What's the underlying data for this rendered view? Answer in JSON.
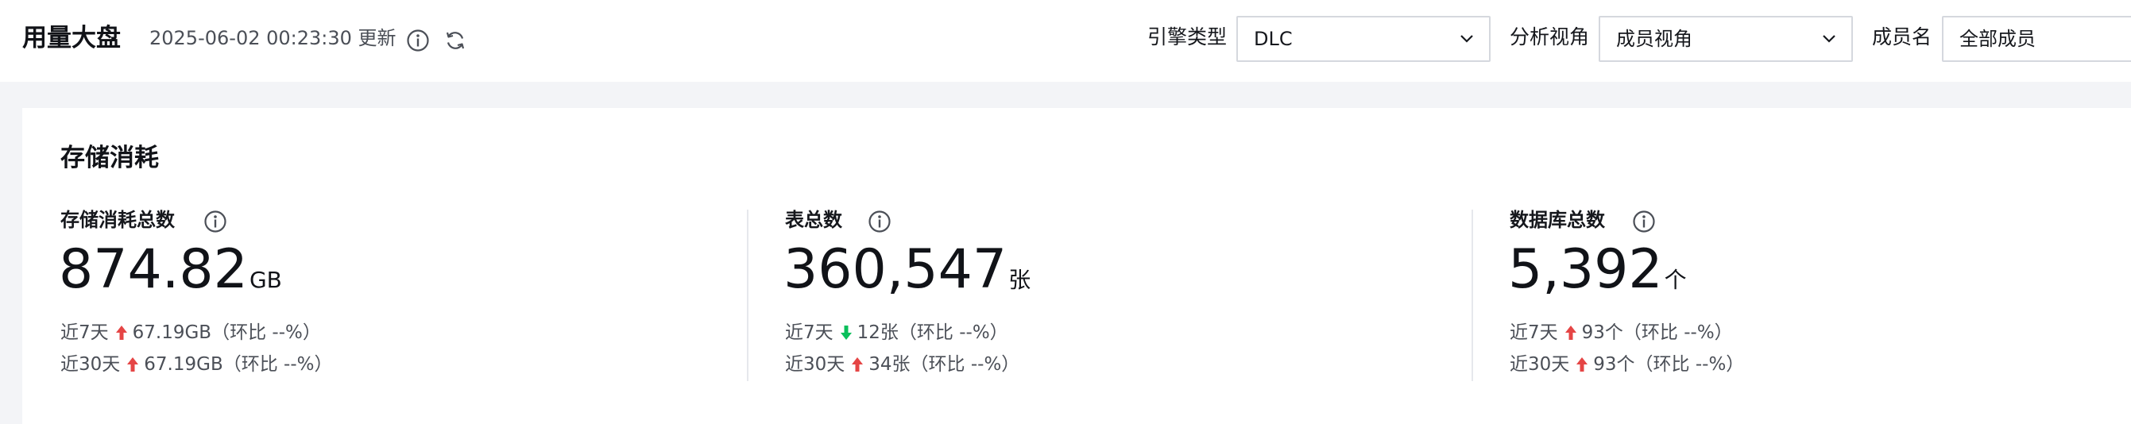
{
  "header": {
    "title": "用量大盘",
    "update_time": "2025-06-02 00:23:30 更新",
    "icons": [
      "info-icon",
      "refresh-icon"
    ]
  },
  "filters": {
    "engine_label": "引擎类型",
    "engine_value": "DLC",
    "view_label": "分析视角",
    "view_value": "成员视角",
    "member_label": "成员名",
    "member_value": "全部成员"
  },
  "storage": {
    "title": "存储消耗",
    "metrics": [
      {
        "label": "存储消耗总数",
        "value": "874.82",
        "unit": "GB",
        "d7_label": "近7天",
        "d7_value": "67.19GB（环比 --%）",
        "d7_direction": "up",
        "d30_label": "近30天",
        "d30_value": "67.19GB（环比 --%）",
        "d30_direction": "up"
      },
      {
        "label": "表总数",
        "value": "360,547",
        "unit": "张",
        "d7_label": "近7天",
        "d7_value": "12张（环比 --%）",
        "d7_direction": "down",
        "d30_label": "近30天",
        "d30_value": "34张（环比 --%）",
        "d30_direction": "up"
      },
      {
        "label": "数据库总数",
        "value": "5,392",
        "unit": "个",
        "d7_label": "近7天",
        "d7_value": "93个（环比 --%）",
        "d7_direction": "up",
        "d30_label": "近30天",
        "d30_value": "93个（环比 --%）",
        "d30_direction": "up"
      }
    ]
  },
  "colors": {
    "up": "#e54545",
    "down": "#0abf5b",
    "border": "#d5d8de",
    "page_bg": "#f3f4f7"
  }
}
